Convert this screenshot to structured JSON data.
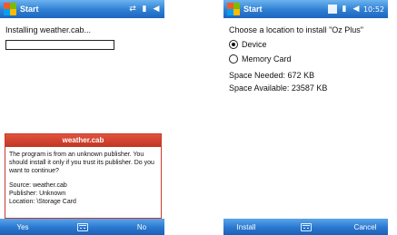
{
  "left_screen": {
    "titlebar": {
      "title": "Start"
    },
    "status_line": "Installing weather.cab...",
    "progress_fraction": 0.0,
    "dialog": {
      "title": "weather.cab",
      "message": "The program is from an unknown publisher. You should install it only if you trust its publisher. Do you want to continue?",
      "source_label": "Source: weather.cab",
      "publisher_label": "Publisher: Unknown",
      "location_label": "Location: \\Storage Card"
    },
    "softkeys": {
      "left": "Yes",
      "right": "No"
    }
  },
  "right_screen": {
    "titlebar": {
      "title": "Start",
      "clock": "10:52"
    },
    "prompt": "Choose a location to install \"Oz Plus\"",
    "options": [
      {
        "label": "Device",
        "checked": true
      },
      {
        "label": "Memory Card",
        "checked": false
      }
    ],
    "space_needed": "Space Needed: 672 KB",
    "space_available": "Space Available: 23587 KB",
    "softkeys": {
      "left": "Install",
      "right": "Cancel"
    }
  },
  "icons": {
    "start": "windows-flag-icon",
    "connectivity": "connectivity-icon",
    "signal": "signal-icon",
    "volume": "speaker-icon",
    "keyboard": "keyboard-icon"
  }
}
